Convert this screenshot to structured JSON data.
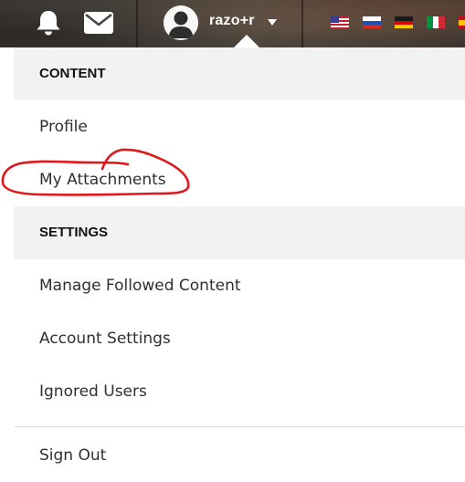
{
  "topbar": {
    "username": "razo+r",
    "icons": [
      "bell-icon",
      "envelope-icon",
      "avatar-icon",
      "caret-down-icon"
    ],
    "flags": [
      "us-flag-icon",
      "russia-flag-icon",
      "germany-flag-icon",
      "italy-flag-icon",
      "spain-flag-icon"
    ]
  },
  "menu": {
    "content_header": "CONTENT",
    "profile": "Profile",
    "my_attachments": "My Attachments",
    "settings_header": "SETTINGS",
    "manage_followed": "Manage Followed Content",
    "account_settings": "Account Settings",
    "ignored_users": "Ignored Users",
    "sign_out": "Sign Out"
  },
  "colors": {
    "section_bg": "#f2f2f2",
    "annotation": "#e0161b"
  }
}
